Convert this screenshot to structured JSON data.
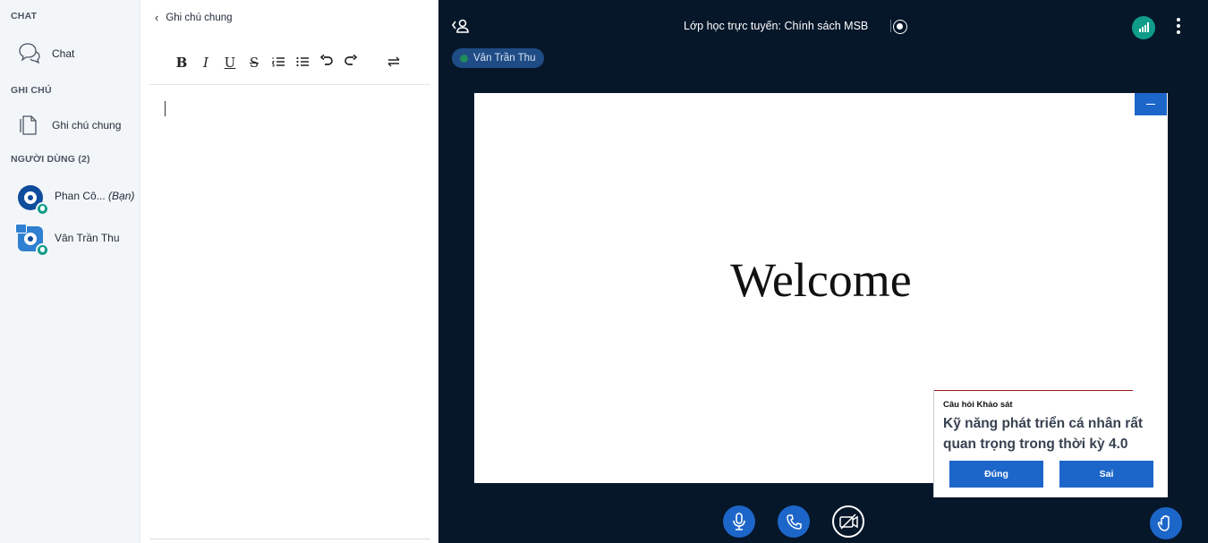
{
  "sidebar": {
    "chat_section": "CHAT",
    "chat_item": "Chat",
    "notes_section": "GHI CHÚ",
    "notes_item": "Ghi chú chung",
    "users_section": "NGƯỜI DÙNG (2)",
    "users": [
      {
        "name": "Phan Cô...",
        "you": "(Bạn)"
      },
      {
        "name": "Vân Trần Thu"
      }
    ]
  },
  "notes_panel": {
    "title": "Ghi chú chung",
    "toolbar": {
      "bold": "B",
      "italic": "I",
      "underline": "U",
      "strike": "S",
      "ordered_list": "☰",
      "bullet_list": "☰",
      "undo": "↶",
      "redo": "↷",
      "swap": "⇄"
    }
  },
  "main": {
    "title": "Lớp học trực tuyến: Chính sách MSB",
    "talking_user": "Vân Trần Thu",
    "slide_text": "Welcome",
    "poll": {
      "heading": "Câu hỏi Khảo sát",
      "question": "Kỹ năng phát triển cá nhân rất quan trọng trong thời kỳ 4.0",
      "option_true": "Đúng",
      "option_false": "Sai"
    }
  },
  "colors": {
    "accent": "#1d66c9",
    "dark_bg": "#06172a",
    "connection": "#0f9d8a"
  }
}
